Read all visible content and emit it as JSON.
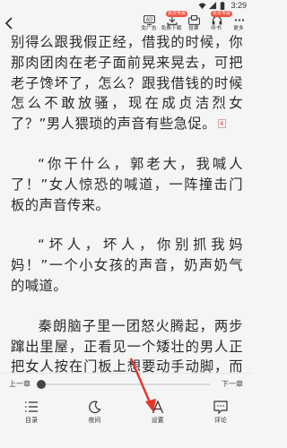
{
  "status_bar": {
    "time": "3:29"
  },
  "toolbar": {
    "tools": [
      {
        "name": "ad-free",
        "label": "免广告",
        "badge": ""
      },
      {
        "name": "free-download",
        "label": "免费下载",
        "badge": "会员专属"
      },
      {
        "name": "vote",
        "label": "投票",
        "badge": ""
      },
      {
        "name": "listen",
        "label": "听书",
        "badge": "会员专属"
      },
      {
        "name": "more",
        "label": "更多",
        "badge": ""
      }
    ]
  },
  "content": {
    "paragraphs": [
      "别得么跟我假正经，借我的时候，你那肉团肉在老子面前晃来晃去，可把老子馋坏了，怎么？跟我借钱的时候怎么不敢放骚，现在成贞洁烈女了？”男人猥琐的声音有些急促。",
      "“你干什么，郭老大，我喊人了！”女人惊恐的喊道，一阵撞击门板的声音传来。",
      "“坏人，坏人，你别抓我妈妈！”一个小女孩的声音，奶声奶气的喊道。",
      "秦朗脑子里一团怒火腾起，两步蹿出里屋，正看见一个矮壮的男人正把女人按在门板上想要动手动脚，而女人则是极力反抗，两人身边一个四五岁大的小女孩去推矮壮男人，却被矮壮男人一把推倒在地上。"
    ],
    "note_mark": "4"
  },
  "chapter_bar": {
    "prev": "上一章",
    "next": "下一章",
    "progress": 0.0
  },
  "bottom_nav": {
    "items": [
      {
        "name": "catalog",
        "label": "目录"
      },
      {
        "name": "night",
        "label": "夜间"
      },
      {
        "name": "settings",
        "label": "设置"
      },
      {
        "name": "comments",
        "label": "评论"
      }
    ]
  },
  "colors": {
    "background": "#f5f5f5",
    "text": "#2a2a2a",
    "badge": "#f2533f",
    "annotation_arrow": "#e8332b"
  }
}
